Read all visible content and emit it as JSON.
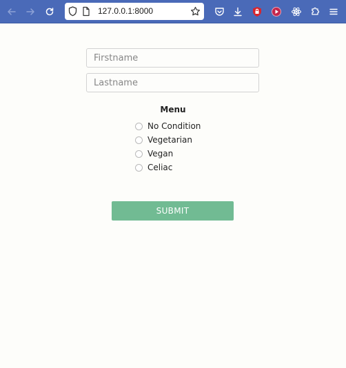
{
  "browser": {
    "url": "127.0.0.1:8000",
    "toolbar_color": "#4a6ab8",
    "icons": [
      "back-arrow-icon",
      "forward-arrow-icon",
      "reload-icon",
      "shield-icon",
      "page-icon",
      "bookmark-star-icon",
      "pocket-icon",
      "download-icon",
      "extension-red-lock-icon",
      "extension-red-record-icon",
      "react-devtools-icon",
      "extensions-puzzle-icon",
      "menu-hamburger-icon"
    ]
  },
  "form": {
    "firstname_placeholder": "Firstname",
    "lastname_placeholder": "Lastname",
    "menu_title": "Menu",
    "options": [
      {
        "label": "No Condition",
        "checked": false
      },
      {
        "label": "Vegetarian",
        "checked": false
      },
      {
        "label": "Vegan",
        "checked": false
      },
      {
        "label": "Celiac",
        "checked": false
      }
    ],
    "submit_label": "SUBMIT",
    "submit_color": "#71bb93"
  }
}
